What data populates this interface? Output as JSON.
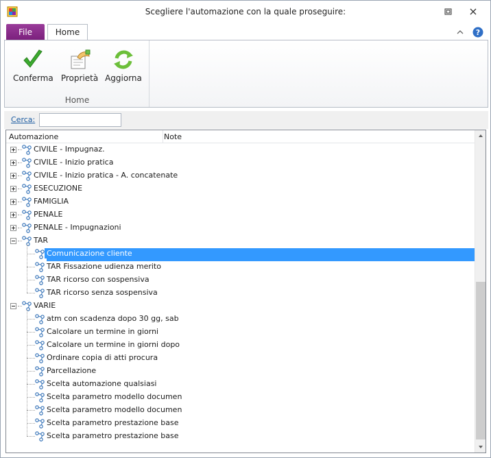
{
  "window": {
    "title": "Scegliere l'automazione con la quale proseguire:"
  },
  "ribbon": {
    "tabs": {
      "file": "File",
      "home": "Home"
    },
    "buttons": {
      "confirm": "Conferma",
      "properties": "Proprietà",
      "refresh": "Aggiorna"
    },
    "group_label": "Home"
  },
  "search": {
    "label": "Cerca:",
    "value": "",
    "placeholder": ""
  },
  "list": {
    "columns": [
      "Automazione",
      "Note"
    ],
    "rows": [
      {
        "label": "CIVILE - Impugnaz.",
        "level": 0,
        "state": "collapsed"
      },
      {
        "label": "CIVILE - Inizio pratica",
        "level": 0,
        "state": "collapsed"
      },
      {
        "label": "CIVILE - Inizio pratica - A. concatenate",
        "level": 0,
        "state": "collapsed"
      },
      {
        "label": "ESECUZIONE",
        "level": 0,
        "state": "collapsed"
      },
      {
        "label": "FAMIGLIA",
        "level": 0,
        "state": "collapsed"
      },
      {
        "label": "PENALE",
        "level": 0,
        "state": "collapsed"
      },
      {
        "label": "PENALE - Impugnazioni",
        "level": 0,
        "state": "collapsed"
      },
      {
        "label": "TAR",
        "level": 0,
        "state": "expanded"
      },
      {
        "label": "Comunicazione cliente",
        "level": 1,
        "state": "leaf",
        "selected": true
      },
      {
        "label": "TAR Fissazione udienza merito",
        "level": 1,
        "state": "leaf"
      },
      {
        "label": "TAR ricorso con sospensiva",
        "level": 1,
        "state": "leaf"
      },
      {
        "label": "TAR ricorso senza sospensiva",
        "level": 1,
        "state": "leaf"
      },
      {
        "label": "VARIE",
        "level": 0,
        "state": "expanded"
      },
      {
        "label": "atm con scadenza dopo 30 gg, sab",
        "level": 1,
        "state": "leaf"
      },
      {
        "label": "Calcolare un termine in giorni",
        "level": 1,
        "state": "leaf"
      },
      {
        "label": "Calcolare un termine in giorni dopo",
        "level": 1,
        "state": "leaf"
      },
      {
        "label": "Ordinare copia di atti procura",
        "level": 1,
        "state": "leaf"
      },
      {
        "label": "Parcellazione",
        "level": 1,
        "state": "leaf"
      },
      {
        "label": "Scelta automazione qualsiasi",
        "level": 1,
        "state": "leaf"
      },
      {
        "label": "Scelta parametro modello documen",
        "level": 1,
        "state": "leaf"
      },
      {
        "label": "Scelta parametro modello documen",
        "level": 1,
        "state": "leaf"
      },
      {
        "label": "Scelta parametro prestazione base",
        "level": 1,
        "state": "leaf"
      },
      {
        "label": "Scelta parametro prestazione base",
        "level": 1,
        "state": "leaf"
      }
    ]
  },
  "colors": {
    "selection": "#3399ff",
    "file_tab": "#8a2c8c",
    "accent_link": "#1a5aa0"
  },
  "icons": [
    "app-icon",
    "restore-icon",
    "close-icon",
    "collapse-ribbon-icon",
    "help-icon",
    "checkmark-icon",
    "properties-icon",
    "refresh-icon",
    "expand-icon",
    "collapse-icon",
    "automation-node-icon"
  ]
}
